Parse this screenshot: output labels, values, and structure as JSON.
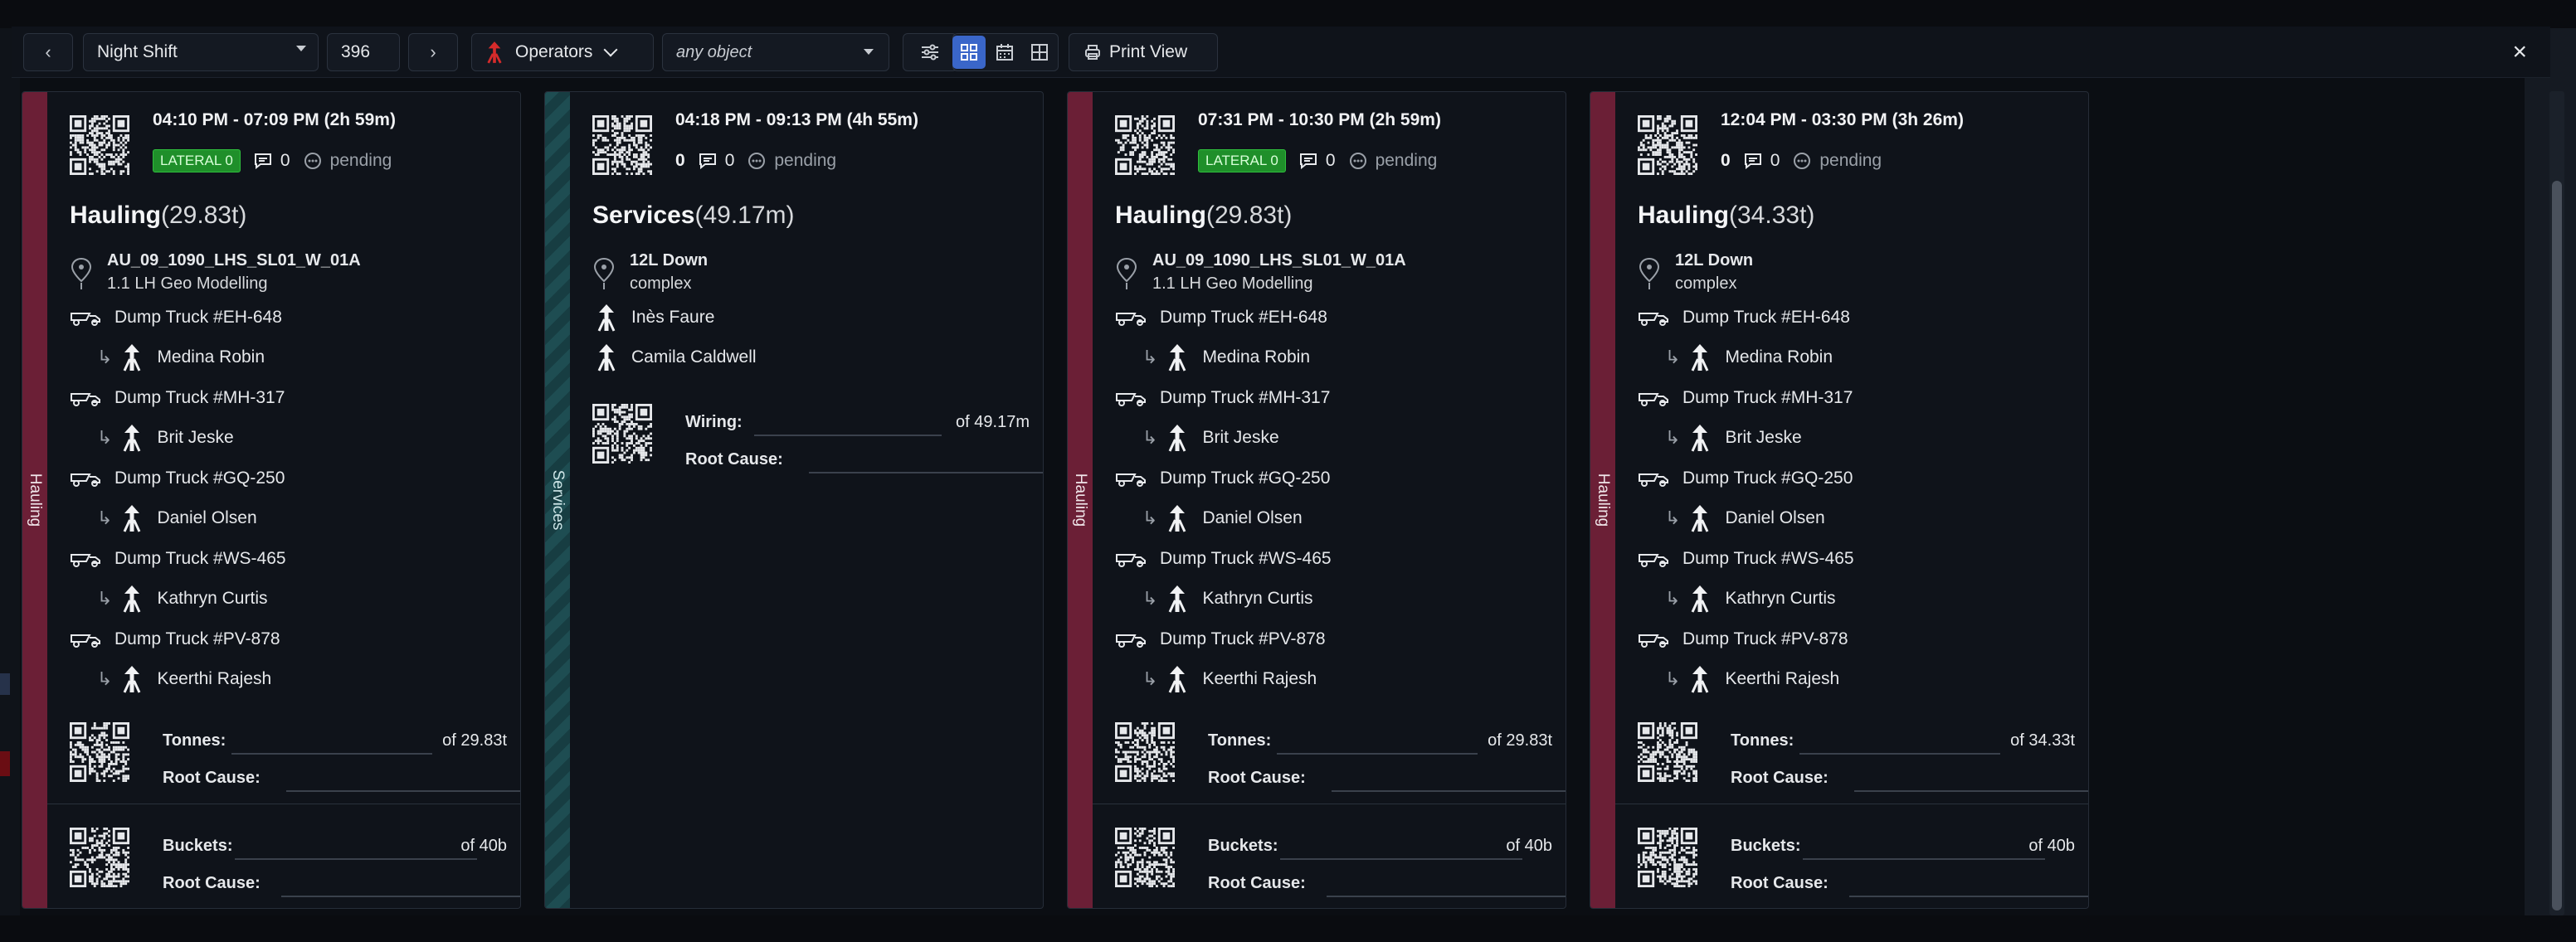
{
  "toolbar": {
    "prev": "‹",
    "next": "›",
    "shift": "Night Shift",
    "number": "396",
    "operators": "Operators",
    "object_filter": "any object",
    "print_view": "Print View",
    "close": "×"
  },
  "cards": [
    {
      "side_label": "Hauling",
      "time": "04:10 PM - 07:09 PM (2h 59m)",
      "badge": "LATERAL 0",
      "comments": "0",
      "status": "pending",
      "activity": "Hauling",
      "quantity": "(29.83t)",
      "location_name": "AU_09_1090_LHS_SL01_W_01A",
      "location_sub": "1.1 LH Geo Modelling",
      "equipment": [
        {
          "truck": "Dump Truck #EH-648",
          "operator": "Medina Robin"
        },
        {
          "truck": "Dump Truck #MH-317",
          "operator": "Brit Jeske"
        },
        {
          "truck": "Dump Truck #GQ-250",
          "operator": "Daniel Olsen"
        },
        {
          "truck": "Dump Truck #WS-465",
          "operator": "Kathryn Curtis"
        },
        {
          "truck": "Dump Truck #PV-878",
          "operator": "Keerthi Rajesh"
        }
      ],
      "field1_label": "Tonnes:",
      "field1_total": "of 29.83t",
      "field2_label": "Buckets:",
      "field2_total": "of 40b",
      "root_cause": "Root Cause:"
    },
    {
      "side_label": "Services",
      "time": "04:18 PM - 09:13 PM (4h 55m)",
      "badge_count": "0",
      "comments": "0",
      "status": "pending",
      "activity": "Services",
      "quantity": "(49.17m)",
      "location_name": "12L Down",
      "location_sub": "complex",
      "operators": [
        "Inès Faure",
        "Camila Caldwell"
      ],
      "field1_label": "Wiring:",
      "field1_total": "of 49.17m",
      "root_cause": "Root Cause:"
    },
    {
      "side_label": "Hauling",
      "time": "07:31 PM - 10:30 PM (2h 59m)",
      "badge": "LATERAL 0",
      "comments": "0",
      "status": "pending",
      "activity": "Hauling",
      "quantity": "(29.83t)",
      "location_name": "AU_09_1090_LHS_SL01_W_01A",
      "location_sub": "1.1 LH Geo Modelling",
      "equipment": [
        {
          "truck": "Dump Truck #EH-648",
          "operator": "Medina Robin"
        },
        {
          "truck": "Dump Truck #MH-317",
          "operator": "Brit Jeske"
        },
        {
          "truck": "Dump Truck #GQ-250",
          "operator": "Daniel Olsen"
        },
        {
          "truck": "Dump Truck #WS-465",
          "operator": "Kathryn Curtis"
        },
        {
          "truck": "Dump Truck #PV-878",
          "operator": "Keerthi Rajesh"
        }
      ],
      "field1_label": "Tonnes:",
      "field1_total": "of 29.83t",
      "field2_label": "Buckets:",
      "field2_total": "of 40b",
      "root_cause": "Root Cause:"
    },
    {
      "side_label": "Hauling",
      "time": "12:04 PM - 03:30 PM (3h 26m)",
      "badge_count": "0",
      "comments": "0",
      "status": "pending",
      "activity": "Hauling",
      "quantity": "(34.33t)",
      "location_name": "12L Down",
      "location_sub": "complex",
      "equipment": [
        {
          "truck": "Dump Truck #EH-648",
          "operator": "Medina Robin"
        },
        {
          "truck": "Dump Truck #MH-317",
          "operator": "Brit Jeske"
        },
        {
          "truck": "Dump Truck #GQ-250",
          "operator": "Daniel Olsen"
        },
        {
          "truck": "Dump Truck #WS-465",
          "operator": "Kathryn Curtis"
        },
        {
          "truck": "Dump Truck #PV-878",
          "operator": "Keerthi Rajesh"
        }
      ],
      "field1_label": "Tonnes:",
      "field1_total": "of 34.33t",
      "field2_label": "Buckets:",
      "field2_total": "of 40b",
      "root_cause": "Root Cause:"
    }
  ],
  "icons": {
    "qr": "qr-code-icon",
    "comment": "comment-icon",
    "pending": "pending-icon",
    "pin": "location-pin-icon",
    "truck": "dump-truck-icon",
    "operator": "operator-icon",
    "filter": "sliders-icon",
    "grid": "grid-view-icon",
    "calendar": "calendar-view-icon",
    "table": "table-view-icon",
    "print": "printer-icon"
  },
  "colors": {
    "hauling": "#6b1f36",
    "services": "#1e4d52",
    "lateral_badge": "#1f8f2a",
    "active_view": "#3a66c9",
    "operators_icon": "#d62b2b"
  }
}
